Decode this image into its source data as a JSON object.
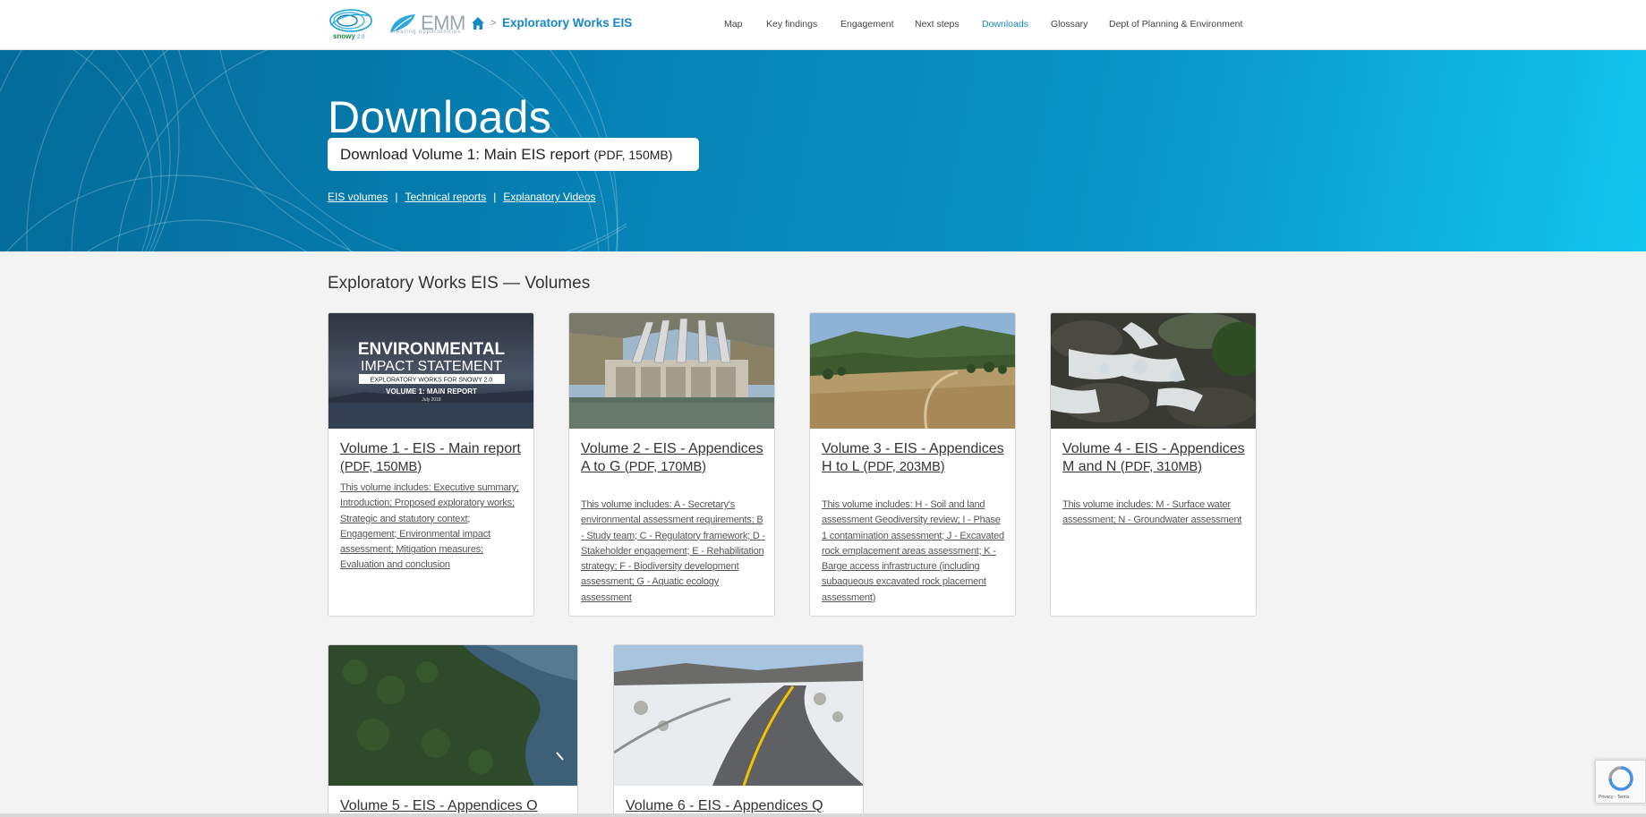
{
  "header": {
    "logo_snowy": "snowy2.0",
    "logo_emm": "EMM",
    "logo_emm_tagline": "creating opportunities",
    "breadcrumb_separator": ">",
    "breadcrumb_title": "Exploratory Works EIS",
    "nav": [
      {
        "label": "Map",
        "active": false
      },
      {
        "label": "Key findings",
        "active": false
      },
      {
        "label": "Engagement",
        "active": false
      },
      {
        "label": "Next steps",
        "active": false
      },
      {
        "label": "Downloads",
        "active": true
      },
      {
        "label": "Glossary",
        "active": false
      },
      {
        "label": "Dept of Planning & Environment",
        "active": false
      }
    ]
  },
  "hero": {
    "title": "Downloads",
    "button_label": "Download Volume 1: Main EIS report",
    "button_meta": "(PDF, 150MB)",
    "links": [
      "EIS volumes",
      "Technical reports",
      "Explanatory Videos"
    ],
    "separator": "|"
  },
  "section": {
    "title": "Exploratory Works EIS — Volumes"
  },
  "cards": [
    {
      "title": "Volume 1 - EIS - Main report",
      "meta": "(PDF, 150MB)",
      "description": "This volume includes: Executive summary; Introduction; Proposed exploratory works; Strategic and statutory context; Engagement; Environmental impact assessment; Mitigation measures; Evaluation and conclusion",
      "cover_heading": "ENVIRONMENTAL",
      "cover_subheading": "IMPACT STATEMENT",
      "cover_tag": "EXPLORATORY WORKS FOR SNOWY 2.0",
      "cover_volume": "VOLUME 1: MAIN REPORT",
      "cover_date": "July 2018"
    },
    {
      "title": "Volume 2 - EIS - Appendices A to G",
      "meta": "(PDF, 170MB)",
      "description": "This volume includes: A - Secretary's environmental assessment requirements; B - Study team; C - Regulatory framework; D - Stakeholder engagement; E - Rehabilitation strategy; F - Biodiversity development assessment; G - Aquatic ecology assessment"
    },
    {
      "title": "Volume 3 - EIS - Appendices H to L",
      "meta": "(PDF, 203MB)",
      "description": "This volume includes: H - Soil and land assessment Geodiversity review; I - Phase 1 contamination assessment; J - Excavated rock emplacement areas assessment; K - Barge access infrastructure (including subaqueous excavated rock placement assessment)"
    },
    {
      "title": "Volume 4 - EIS - Appendices M and N",
      "meta": "(PDF, 310MB)",
      "description": "This volume includes: M - Surface water assessment; N - Groundwater assessment"
    },
    {
      "title": "Volume 5 - EIS - Appendices O",
      "meta": "",
      "description": ""
    },
    {
      "title": "Volume 6 - EIS - Appendices Q",
      "meta": "",
      "description": ""
    }
  ],
  "recaptcha": {
    "footer": "Privacy - Terms"
  },
  "colors": {
    "accent": "#1688c4",
    "hero_dark": "#046b9a",
    "hero_light": "#12c6ee"
  }
}
